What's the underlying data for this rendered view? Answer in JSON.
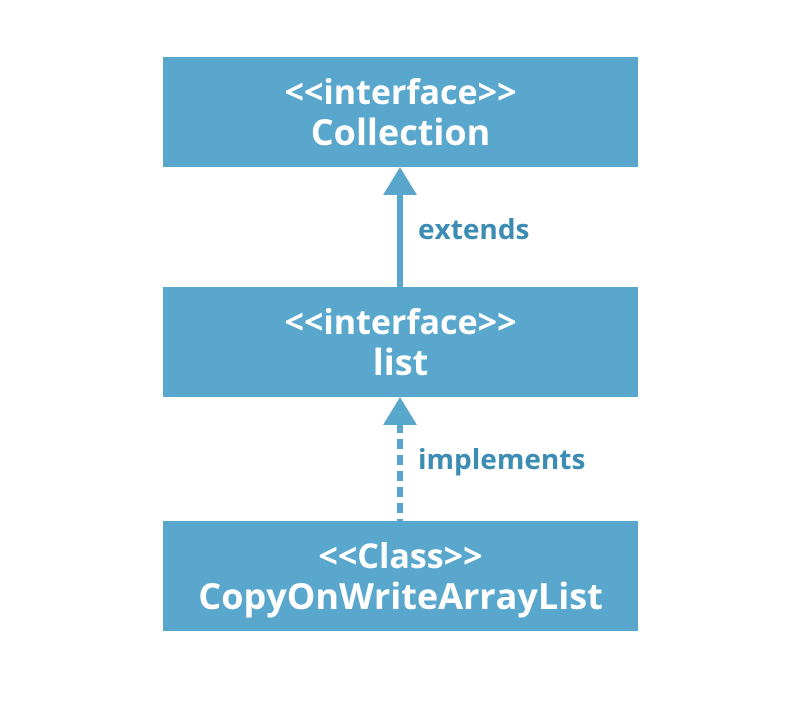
{
  "boxes": {
    "collection": {
      "stereotype": "<<interface>>",
      "name": "Collection"
    },
    "list": {
      "stereotype": "<<interface>>",
      "name": "list"
    },
    "cowal": {
      "stereotype": "<<Class>>",
      "name": "CopyOnWriteArrayList"
    }
  },
  "labels": {
    "extends": "extends",
    "implements": "implements"
  },
  "colors": {
    "fill": "#59a7cc",
    "labelText": "#3c8cb4"
  }
}
